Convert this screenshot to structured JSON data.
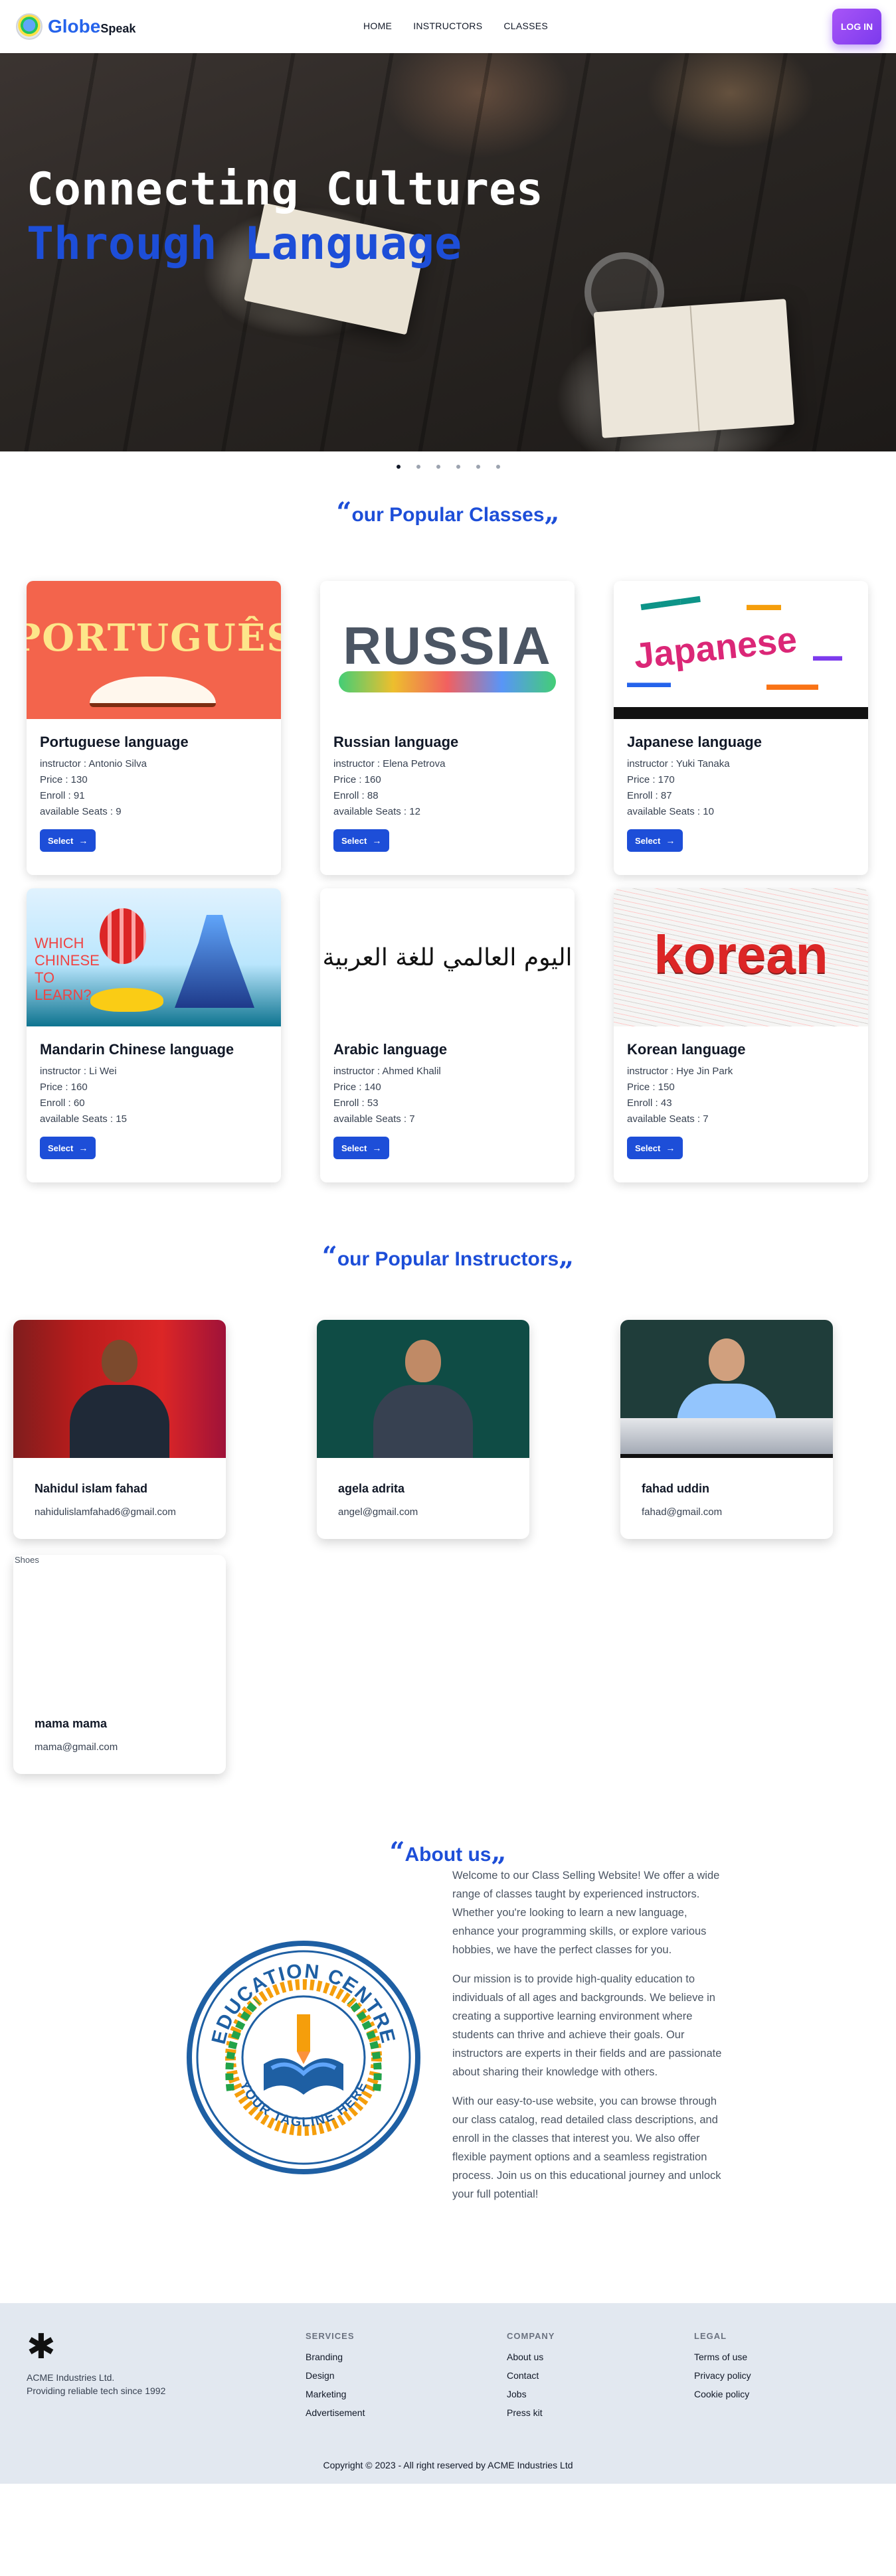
{
  "nav": {
    "brand_primary": "Globe",
    "brand_secondary": "Speak",
    "links": [
      "HOME",
      "INSTRUCTORS",
      "CLASSES"
    ],
    "login_label": "LOG IN"
  },
  "hero": {
    "title_line1": "Connecting Cultures",
    "title_line2": "Through Language",
    "slide_count": 6,
    "active_slide": 1
  },
  "classes_section": {
    "open_quote": "“",
    "title": "our Popular Classes",
    "close_quote": "„",
    "select_label": "Select",
    "items": [
      {
        "name": "Portuguese language",
        "instructor": "instructor : Antonio Silva",
        "price": "Price : 130",
        "enroll": "Enroll : 91",
        "seats": "available Seats : 9",
        "image_text": "PORTUGUÊS"
      },
      {
        "name": "Russian language",
        "instructor": "instructor : Elena Petrova",
        "price": "Price : 160",
        "enroll": "Enroll : 88",
        "seats": "available Seats : 12",
        "image_text": "RUSSIA"
      },
      {
        "name": "Japanese language",
        "instructor": "instructor : Yuki Tanaka",
        "price": "Price : 170",
        "enroll": "Enroll : 87",
        "seats": "available Seats : 10",
        "image_text": "Japanese"
      },
      {
        "name": "Mandarin Chinese language",
        "instructor": "instructor : Li Wei",
        "price": "Price : 160",
        "enroll": "Enroll : 60",
        "seats": "available Seats : 15",
        "image_text": "WHICH CHINESE TO LEARN?"
      },
      {
        "name": "Arabic language",
        "instructor": "instructor : Ahmed Khalil",
        "price": "Price : 140",
        "enroll": "Enroll : 53",
        "seats": "available Seats : 7",
        "image_text": "اليوم العالمي للغة العربية"
      },
      {
        "name": "Korean language",
        "instructor": "instructor : Hye Jin Park",
        "price": "Price : 150",
        "enroll": "Enroll : 43",
        "seats": "available Seats : 7",
        "image_text": "korean"
      }
    ]
  },
  "instructors_section": {
    "open_quote": "“",
    "title": "our Popular Instructors",
    "close_quote": "„",
    "items": [
      {
        "name": "Nahidul islam fahad",
        "email": "nahidulislamfahad6@gmail.com"
      },
      {
        "name": "agela adrita",
        "email": "angel@gmail.com"
      },
      {
        "name": "fahad uddin",
        "email": "fahad@gmail.com"
      },
      {
        "name": "mama mama",
        "email": "mama@gmail.com",
        "broken_image_alt": "Shoes"
      }
    ]
  },
  "about_section": {
    "open_quote": "“",
    "title": "About us",
    "close_quote": "„",
    "logo_top_text": "EDUCATION CENTRE",
    "logo_bottom_text": "YOUR TAGLINE HERE",
    "paragraphs": [
      "Welcome to our Class Selling Website! We offer a wide range of classes taught by experienced instructors. Whether you're looking to learn a new language, enhance your programming skills, or explore various hobbies, we have the perfect classes for you.",
      "Our mission is to provide high-quality education to individuals of all ages and backgrounds. We believe in creating a supportive learning environment where students can thrive and achieve their goals. Our instructors are experts in their fields and are passionate about sharing their knowledge with others.",
      "With our easy-to-use website, you can browse through our class catalog, read detailed class descriptions, and enroll in the classes that interest you. We also offer flexible payment options and a seamless registration process. Join us on this educational journey and unlock your full potential!"
    ]
  },
  "footer": {
    "company_name": "ACME Industries Ltd.",
    "tagline": "Providing reliable tech since 1992",
    "services_title": "SERVICES",
    "services": [
      "Branding",
      "Design",
      "Marketing",
      "Advertisement"
    ],
    "company_title": "COMPANY",
    "company_links": [
      "About us",
      "Contact",
      "Jobs",
      "Press kit"
    ],
    "legal_title": "LEGAL",
    "legal_links": [
      "Terms of use",
      "Privacy policy",
      "Cookie policy"
    ],
    "copyright": "Copyright © 2023 - All right reserved by ACME Industries Ltd"
  },
  "colors": {
    "primary_blue": "#1d4ed8",
    "login_purple": "#7c3aed",
    "footer_bg": "#e2e8f0"
  }
}
